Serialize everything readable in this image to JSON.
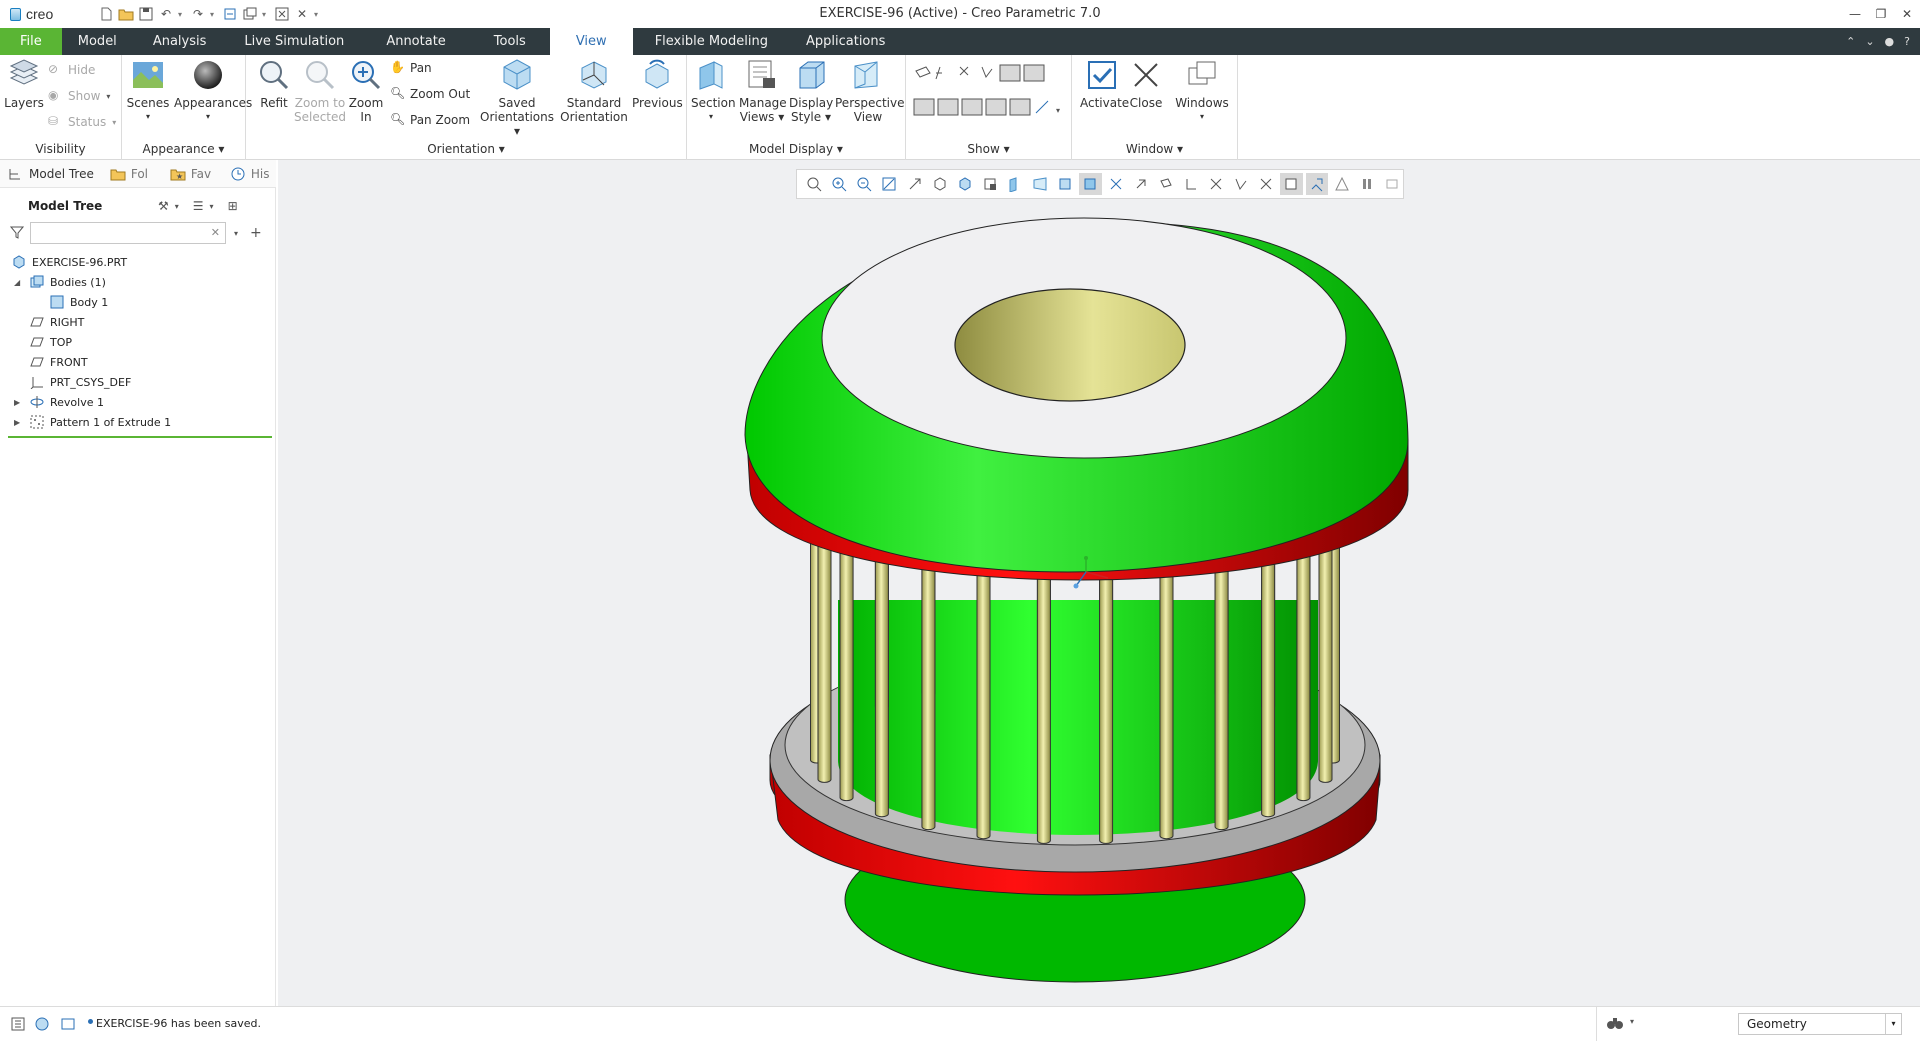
{
  "app": {
    "logo_text": "creo",
    "window_title": "EXERCISE-96 (Active) - Creo Parametric 7.0"
  },
  "tabs": [
    {
      "label": "File"
    },
    {
      "label": "Model"
    },
    {
      "label": "Analysis"
    },
    {
      "label": "Live Simulation"
    },
    {
      "label": "Annotate"
    },
    {
      "label": "Tools"
    },
    {
      "label": "View"
    },
    {
      "label": "Flexible Modeling"
    },
    {
      "label": "Applications"
    }
  ],
  "ribbon": {
    "visibility": {
      "label": "Visibility",
      "layers": "Layers",
      "hide": "Hide",
      "show": "Show",
      "status": "Status"
    },
    "appearance": {
      "label": "Appearance",
      "scenes": "Scenes",
      "appearances": "Appearances"
    },
    "orientation": {
      "label": "Orientation",
      "refit": "Refit",
      "zoom_sel_1": "Zoom to",
      "zoom_sel_2": "Selected",
      "zoom_in_1": "Zoom",
      "zoom_in_2": "In",
      "pan": "Pan",
      "zoom_out": "Zoom Out",
      "pan_zoom": "Pan Zoom",
      "saved_1": "Saved",
      "saved_2": "Orientations",
      "standard_1": "Standard",
      "standard_2": "Orientation",
      "previous": "Previous"
    },
    "model_display": {
      "label": "Model Display",
      "section": "Section",
      "manage_1": "Manage",
      "manage_2": "Views",
      "display_1": "Display",
      "display_2": "Style",
      "persp_1": "Perspective",
      "persp_2": "View"
    },
    "show": {
      "label": "Show"
    },
    "window": {
      "label": "Window",
      "activate": "Activate",
      "close": "Close",
      "windows": "Windows"
    }
  },
  "panel_tabs": [
    {
      "label": "Model Tree"
    },
    {
      "label": "Fol"
    },
    {
      "label": "Fav"
    },
    {
      "label": "His"
    }
  ],
  "model_tree": {
    "header": "Model Tree",
    "search_placeholder": "",
    "nodes": [
      {
        "label": "EXERCISE-96.PRT",
        "icon": "part-icon"
      },
      {
        "label": "Bodies (1)",
        "icon": "bodies-icon"
      },
      {
        "label": "Body 1",
        "icon": "body-icon"
      },
      {
        "label": "RIGHT",
        "icon": "datum-plane-icon"
      },
      {
        "label": "TOP",
        "icon": "datum-plane-icon"
      },
      {
        "label": "FRONT",
        "icon": "datum-plane-icon"
      },
      {
        "label": "PRT_CSYS_DEF",
        "icon": "csys-icon"
      },
      {
        "label": "Revolve 1",
        "icon": "revolve-icon"
      },
      {
        "label": "Pattern 1 of Extrude 1",
        "icon": "pattern-icon"
      }
    ]
  },
  "status": {
    "message": "EXERCISE-96 has been saved.",
    "filter_value": "Geometry"
  },
  "colors": {
    "accent_green": "#5ab534",
    "tab_bar": "#2f3a3f",
    "active_tab_text": "#2f6fb2",
    "model_green": "#00dd00",
    "model_red": "#e00000",
    "model_yellow": "#e5e396",
    "viewport_bg": "#eff0f2"
  }
}
